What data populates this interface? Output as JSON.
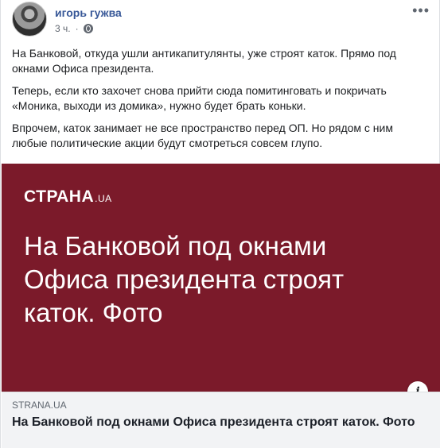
{
  "post": {
    "author": "игорь гужва",
    "time": "3 ч.",
    "paragraphs": [
      "На Банковой, откуда ушли антикапитулянты, уже строят каток. Прямо под окнами Офиса президента.",
      "Теперь, если кто захочет снова прийти сюда помитинговать и покричать «Моника, выходи из домика», нужно будет брать коньки.",
      "Впрочем, каток занимает не все пространство перед ОП. Но рядом с ним любые политические акции будут смотреться совсем глупо."
    ],
    "more_label": "•••",
    "privacy_icon": "globe-icon"
  },
  "hero": {
    "brand": "СТРАНА",
    "brand_tld": ".UA",
    "title": "На Банковой под окнами Офиса президента строят каток. Фото",
    "background_color": "#7b1a2a"
  },
  "link": {
    "domain": "STRANA.UA",
    "title": "На Банковой под окнами Офиса президента строят каток. Фото",
    "info_label": "i"
  }
}
